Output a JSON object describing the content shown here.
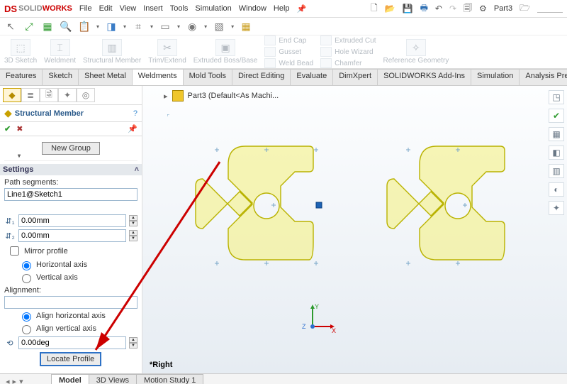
{
  "app": {
    "name_prefix": "SOLID",
    "name_suffix": "WORKS"
  },
  "menu": [
    "File",
    "Edit",
    "View",
    "Insert",
    "Tools",
    "Simulation",
    "Window",
    "Help"
  ],
  "doc_name": "Part3",
  "ribbon": {
    "groups": [
      "3D Sketch",
      "Weldment",
      "Structural Member",
      "Trim/Extend",
      "Extruded Boss/Base"
    ],
    "stacksA": [
      "End Cap",
      "Gusset",
      "Weld Bead"
    ],
    "stacksB": [
      "Extruded Cut",
      "Hole Wizard",
      "Chamfer"
    ],
    "ref": "Reference Geometry"
  },
  "cmd_tabs": [
    "Features",
    "Sketch",
    "Sheet Metal",
    "Weldments",
    "Mold Tools",
    "Direct Editing",
    "Evaluate",
    "DimXpert",
    "SOLIDWORKS Add-Ins",
    "Simulation",
    "Analysis Preparation"
  ],
  "active_cmd_tab": 3,
  "feature_panel": {
    "title": "Structural Member",
    "btn_new_group": "New Group",
    "settings_label": "Settings",
    "path_label": "Path segments:",
    "path_value": "Line1@Sketch1",
    "d1": "0.00mm",
    "d2": "0.00mm",
    "mirror": "Mirror profile",
    "mirror_h": "Horizontal axis",
    "mirror_v": "Vertical axis",
    "align_label": "Alignment:",
    "align_h": "Align horizontal axis",
    "align_v": "Align vertical axis",
    "angle": "0.00deg",
    "locate": "Locate Profile"
  },
  "breadcrumb": "Part3  (Default<As Machi...",
  "right_label": "*Right",
  "bottom_tabs": [
    "Model",
    "3D Views",
    "Motion Study 1"
  ],
  "active_bottom_tab": 0
}
